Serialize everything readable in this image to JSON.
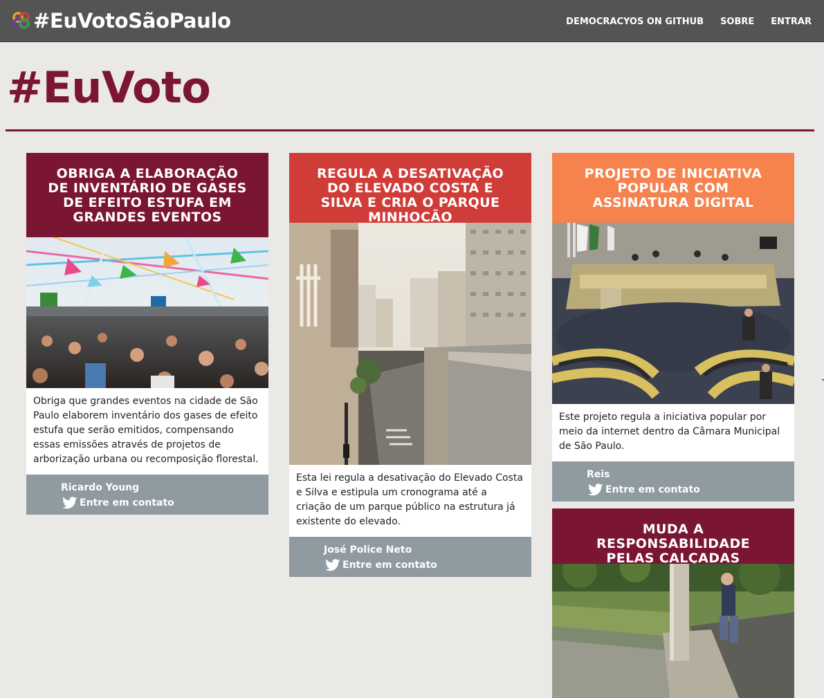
{
  "navbar": {
    "brand": "#EuVotoSãoPaulo",
    "links": [
      "DEMOCRACYOS ON GITHUB",
      "SOBRE",
      "ENTRAR"
    ]
  },
  "page": {
    "title": "#EuVoto"
  },
  "cards": [
    {
      "title": "OBRIGA A ELABORAÇÃO DE INVENTÁRIO DE GASES DE EFEITO ESTUFA EM GRANDES EVENTOS",
      "description": "Obriga que grandes eventos na cidade de São Paulo elaborem inventário dos gases de efeito estufa que serão emitidos, compensando essas emissões através de projetos de arborização urbana ou recomposição florestal.",
      "author": "Ricardo Young",
      "contact": "Entre em contato",
      "color": "#7a1534"
    },
    {
      "title": "REGULA A DESATIVAÇÃO DO ELEVADO COSTA E SILVA E CRIA O PARQUE MINHOCÃO",
      "description": "Esta lei regula a desativação do Elevado Costa e Silva e estipula um cronograma até a criação de um parque público na estrutura já existente do elevado.",
      "author": "José Police Neto",
      "contact": "Entre em contato",
      "color": "#d03c38"
    },
    {
      "title": "PROJETO DE INICIATIVA POPULAR COM ASSINATURA DIGITAL",
      "description": "Este projeto regula a iniciativa popular por meio da internet dentro da Câmara Municipal de São Paulo.",
      "author": "Reis",
      "contact": "Entre em contato",
      "color": "#f6824e"
    },
    {
      "title": "MUDA A RESPONSABILIDADE PELAS CALÇADAS",
      "color": "#7a1534"
    }
  ],
  "colors": {
    "navbar": "#555454",
    "background": "#ebe9e6",
    "footer": "#8f9aa1",
    "accent": "#7a1534"
  },
  "icons": [
    "brand-logo-icon",
    "twitter-icon"
  ]
}
